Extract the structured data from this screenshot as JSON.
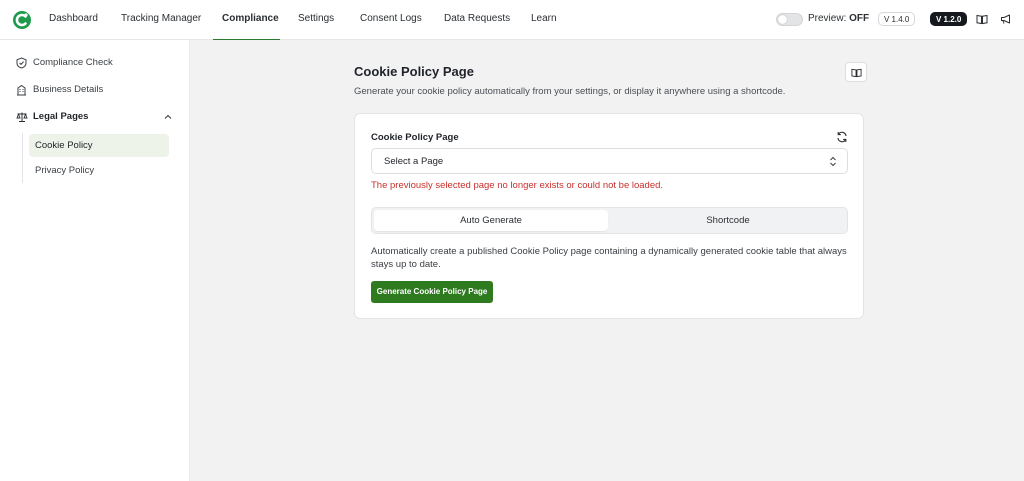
{
  "nav": {
    "items": [
      {
        "label": "Dashboard"
      },
      {
        "label": "Tracking Manager"
      },
      {
        "label": "Compliance"
      },
      {
        "label": "Settings"
      },
      {
        "label": "Consent Logs"
      },
      {
        "label": "Data Requests"
      },
      {
        "label": "Learn"
      }
    ],
    "active": "Compliance",
    "preview_label": "Preview:",
    "preview_state": "OFF",
    "version_badges": [
      "V 1.4.0",
      "V 1.2.0"
    ],
    "icons": [
      "logo-icon",
      "book-icon",
      "megaphone-icon"
    ]
  },
  "sidebar": {
    "items": [
      {
        "label": "Compliance Check",
        "icon": "shield-icon"
      },
      {
        "label": "Business Details",
        "icon": "building-icon"
      },
      {
        "label": "Legal Pages",
        "icon": "scale-icon"
      }
    ],
    "sub_items": [
      {
        "label": "Cookie Policy"
      },
      {
        "label": "Privacy Policy"
      }
    ]
  },
  "main": {
    "title": "Cookie Policy Page",
    "description": "Generate your cookie policy automatically from your settings, or display it anywhere using a shortcode.",
    "card": {
      "field_label": "Cookie Policy Page",
      "select_value": "Select a Page",
      "error": "The previously selected page no longer exists or could not be loaded.",
      "tabs": [
        "Auto Generate",
        "Shortcode"
      ],
      "active_tab": "Auto Generate",
      "text": "Automatically create a published Cookie Policy page containing a dynamically generated cookie table that always stays up to date.",
      "button": "Generate Cookie Policy Page"
    }
  },
  "colors": {
    "accent": "#2d7a1f",
    "error": "#c9302c",
    "active_sub_bg": "#edf3e9",
    "background": "#f2f2f3"
  }
}
